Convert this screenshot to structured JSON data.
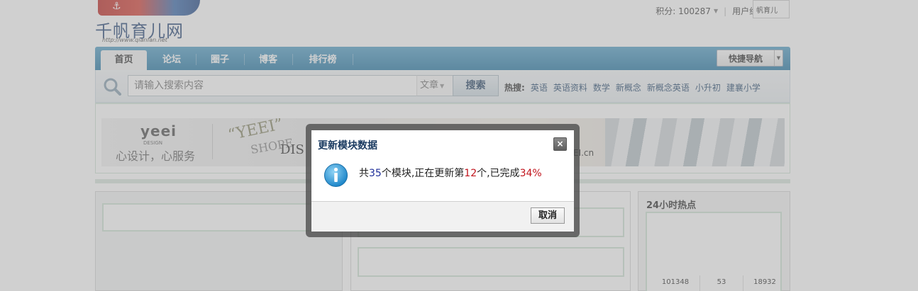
{
  "header": {
    "logo_text": "千帆育儿网",
    "logo_url": "http://www.qianfan.net",
    "points_label": "积分: 100287",
    "usergroup_label": "用户组: 管理员",
    "avatar_text": "帆育儿"
  },
  "nav": {
    "tabs": [
      {
        "label": "首页",
        "active": true
      },
      {
        "label": "论坛"
      },
      {
        "label": "圈子"
      },
      {
        "label": "博客"
      },
      {
        "label": "排行榜"
      }
    ],
    "quicknav_label": "快捷导航"
  },
  "search": {
    "placeholder": "请输入搜索内容",
    "type_label": "文章",
    "button_label": "搜索",
    "hot_label": "热搜:",
    "hot_keywords": [
      "英语",
      "英语资料",
      "数学",
      "新概念",
      "新概念英语",
      "小升初",
      "建襄小学"
    ]
  },
  "banner": {
    "brand": "yeei",
    "brand_sub": "DESIGN",
    "slogan": "心设计，心服务",
    "quote_text": "“YEEI”",
    "shop_text": "SHOPE",
    "dis_text": "DIS",
    "domain_text": "EI.cn"
  },
  "right_panel": {
    "title": "24小时热点",
    "stats": [
      "101348",
      "53",
      "18932"
    ]
  },
  "dialog": {
    "title": "更新模块数据",
    "close_symbol": "×",
    "msg_part1": "共",
    "total_modules": "35",
    "msg_part2": "个模块,正在更新第",
    "current_module": "12",
    "msg_part3": "个,已完成",
    "percent_done": "34%",
    "cancel_label": "取消"
  },
  "colors": {
    "nav_blue": "#2f7ea9",
    "dialog_title": "#1b3b61",
    "highlight_red": "#c1141c",
    "highlight_blue": "#1f2f9a",
    "info_icon": "#2b9ad8"
  }
}
